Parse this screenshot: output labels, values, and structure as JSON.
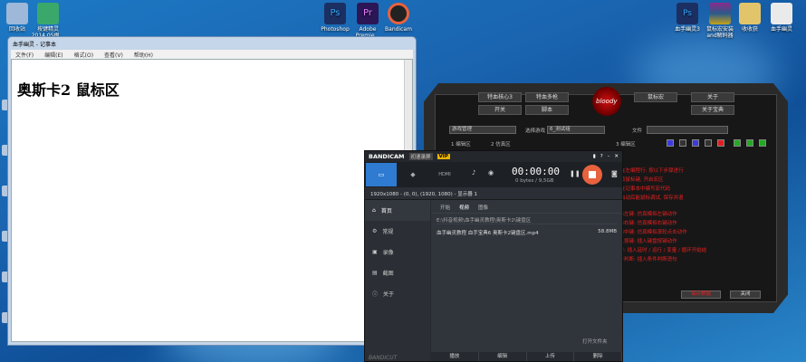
{
  "desktop_icons": [
    {
      "label": "回收站",
      "icon": "recycle-bin-icon",
      "color": "#9db8d8"
    },
    {
      "label": "按键精灵\n2014.05根...",
      "icon": "keyboard-sprite-icon",
      "color": "#3aa86b"
    },
    {
      "label": "Photoshop",
      "icon": "photoshop-icon",
      "color": "#1b2f63"
    },
    {
      "label": "Adobe\nPremie...",
      "icon": "premiere-icon",
      "color": "#2b1656"
    },
    {
      "label": "Bandicam",
      "icon": "bandicam-icon",
      "color": "#222"
    },
    {
      "label": "血手幽灵3",
      "icon": "photoshop-file-icon",
      "color": "#1b2f63"
    },
    {
      "label": "鼠标宏安装\nand解码器",
      "icon": "winrar-icon",
      "color": "#8b2a8b"
    },
    {
      "label": "收收获",
      "icon": "folder-icon",
      "color": "#e2c56b"
    },
    {
      "label": "血手幽灵",
      "icon": "document-icon",
      "color": "#eaeaea"
    }
  ],
  "notepad": {
    "title": "血手幽灵 - 记事本",
    "menu": [
      "文件(F)",
      "编辑(E)",
      "格式(O)",
      "查看(V)",
      "帮助(H)"
    ],
    "content": "奥斯卡2 鼠标区"
  },
  "bloody": {
    "tabs": [
      "特血核心3",
      "特血多枪",
      "开关",
      "脚本",
      "鼠标宏",
      "关于",
      "关于宝典"
    ],
    "logo": "bloody",
    "fields": {
      "game_mgmt": "游戏管理",
      "select_game_label": "选择游戏",
      "select_game_value": "6_测试组",
      "file_label": "文件"
    },
    "slots": [
      "1 编辑区",
      "2 仿真区",
      "3 编辑区"
    ],
    "instructions": [
      "1. 在左编程行: 按以下步骤进行",
      "2. 按鼠标键, 开启宏区",
      "3. 在记事本中编写宏代码",
      "4. 启动后能鼠标调试, 保存并退"
    ],
    "instructions2": [
      "鼠标左键: 仿真模拟左键动作",
      "鼠标右键: 仿真模拟右键动作",
      "鼠标中键: 仿真模拟滚轮点击动作",
      "插入按键: 插入键盘按键动作",
      "延时: 插入延时 / 运行 / 变量 / 循环开始结",
      "条件判断: 插入条件判断语句"
    ],
    "buttons": [
      "保存数据",
      "关闭"
    ]
  },
  "bandicam": {
    "title_badge": "初速录屏",
    "vip": "VIP",
    "timer": "00:00:00",
    "size": "0 bytes / 9,5GB",
    "modes": [
      "screen-mode",
      "game-mode",
      "hdmi-mode"
    ],
    "resolution": "1920x1080 - (0, 0), (1920, 1080) - 显示器 1",
    "nav": [
      "首页",
      "常规",
      "录像",
      "截图",
      "关于"
    ],
    "sub_tabs": [
      "开始",
      "视频",
      "图像"
    ],
    "path": "E:\\抖音视频\\血手幽灵教程\\奥斯卡2\\键盘区",
    "file": {
      "name": "血手幽灵教程 血手宝典6 奥斯卡2键盘区.mp4",
      "size": "58.8MB"
    },
    "folder_btn": "打开文件夹",
    "footer": [
      "播放",
      "编辑",
      "上传",
      "删除"
    ],
    "brand": "BANDICUT"
  }
}
